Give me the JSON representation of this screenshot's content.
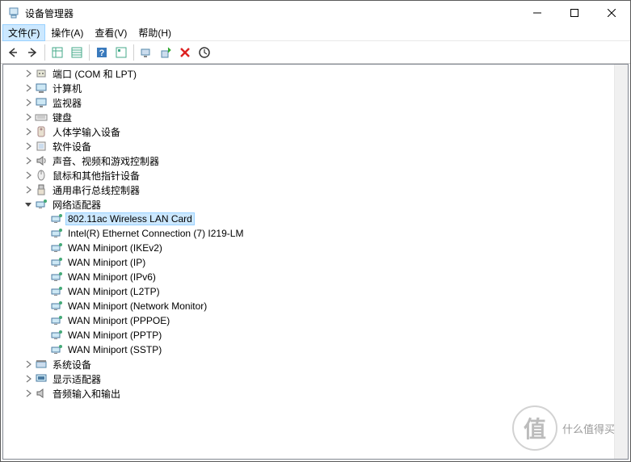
{
  "window": {
    "title": "设备管理器"
  },
  "menu": {
    "file": "文件(F)",
    "action": "操作(A)",
    "view": "查看(V)",
    "help": "帮助(H)"
  },
  "tree": {
    "items": [
      {
        "level": 1,
        "expanded": false,
        "icon": "port",
        "label": "端口 (COM 和 LPT)"
      },
      {
        "level": 1,
        "expanded": false,
        "icon": "computer",
        "label": "计算机"
      },
      {
        "level": 1,
        "expanded": false,
        "icon": "monitor",
        "label": "监视器"
      },
      {
        "level": 1,
        "expanded": false,
        "icon": "keyboard",
        "label": "键盘"
      },
      {
        "level": 1,
        "expanded": false,
        "icon": "hid",
        "label": "人体学输入设备"
      },
      {
        "level": 1,
        "expanded": false,
        "icon": "software",
        "label": "软件设备"
      },
      {
        "level": 1,
        "expanded": false,
        "icon": "audio",
        "label": "声音、视频和游戏控制器"
      },
      {
        "level": 1,
        "expanded": false,
        "icon": "mouse",
        "label": "鼠标和其他指针设备"
      },
      {
        "level": 1,
        "expanded": false,
        "icon": "usb",
        "label": "通用串行总线控制器"
      },
      {
        "level": 1,
        "expanded": true,
        "icon": "network",
        "label": "网络适配器"
      },
      {
        "level": 2,
        "leaf": true,
        "selected": true,
        "icon": "netcard",
        "label": "802.11ac Wireless LAN Card"
      },
      {
        "level": 2,
        "leaf": true,
        "icon": "netcard",
        "label": "Intel(R) Ethernet Connection (7) I219-LM"
      },
      {
        "level": 2,
        "leaf": true,
        "icon": "netcard",
        "label": "WAN Miniport (IKEv2)"
      },
      {
        "level": 2,
        "leaf": true,
        "icon": "netcard",
        "label": "WAN Miniport (IP)"
      },
      {
        "level": 2,
        "leaf": true,
        "icon": "netcard",
        "label": "WAN Miniport (IPv6)"
      },
      {
        "level": 2,
        "leaf": true,
        "icon": "netcard",
        "label": "WAN Miniport (L2TP)"
      },
      {
        "level": 2,
        "leaf": true,
        "icon": "netcard",
        "label": "WAN Miniport (Network Monitor)"
      },
      {
        "level": 2,
        "leaf": true,
        "icon": "netcard",
        "label": "WAN Miniport (PPPOE)"
      },
      {
        "level": 2,
        "leaf": true,
        "icon": "netcard",
        "label": "WAN Miniport (PPTP)"
      },
      {
        "level": 2,
        "leaf": true,
        "icon": "netcard",
        "label": "WAN Miniport (SSTP)"
      },
      {
        "level": 1,
        "expanded": false,
        "icon": "system",
        "label": "系统设备"
      },
      {
        "level": 1,
        "expanded": false,
        "icon": "display",
        "label": "显示适配器"
      },
      {
        "level": 1,
        "expanded": false,
        "icon": "audioio",
        "label": "音频输入和输出"
      }
    ]
  },
  "watermark": {
    "char": "值",
    "text": "什么值得买"
  }
}
